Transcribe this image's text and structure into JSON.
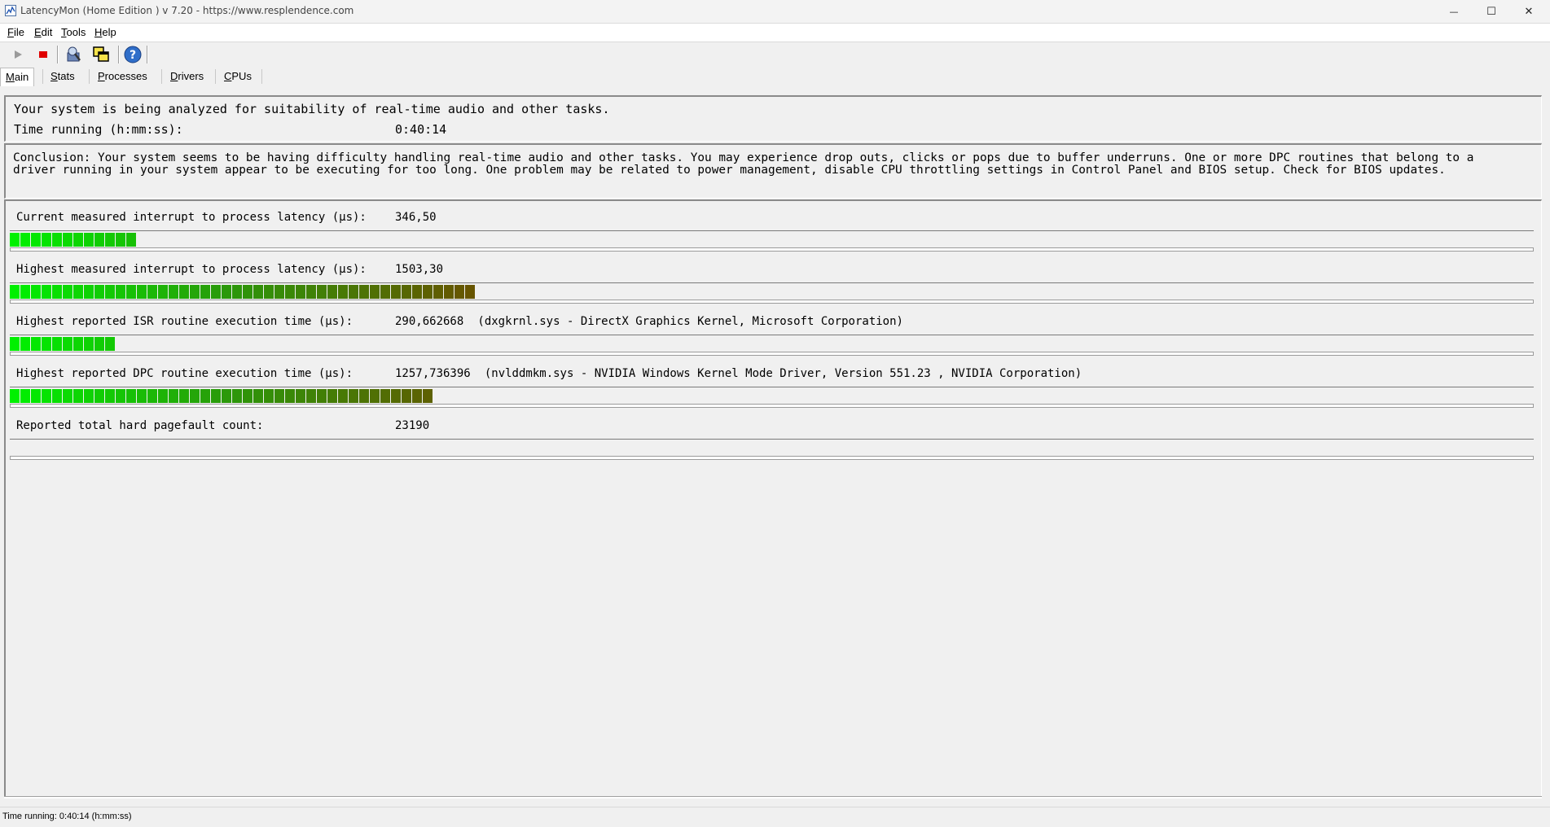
{
  "window": {
    "title": "LatencyMon  (Home Edition )  v 7.20 - https://www.resplendence.com",
    "minimize_glyph": "—",
    "maximize_glyph": "☐",
    "close_glyph": "✕"
  },
  "menu": [
    {
      "key": "F",
      "rest": "ile"
    },
    {
      "key": "E",
      "rest": "dit"
    },
    {
      "key": "T",
      "rest": "ools"
    },
    {
      "key": "H",
      "rest": "elp"
    }
  ],
  "toolbar": {
    "icons": [
      "play-icon",
      "stop-icon",
      "driver-info-icon",
      "windows-icon",
      "help-icon"
    ],
    "stop_color": "#e00000",
    "help_color": "#2f6ec9"
  },
  "tabs": [
    {
      "key": "M",
      "rest": "ain"
    },
    {
      "key": "S",
      "rest": "tats"
    },
    {
      "key": "P",
      "rest": "rocesses"
    },
    {
      "key": "D",
      "rest": "rivers"
    },
    {
      "key": "C",
      "rest": "PUs"
    }
  ],
  "summary": {
    "status": "Your system is being analyzed for suitability of real-time audio and other tasks.",
    "time_label": "Time running (h:mm:ss):",
    "time_value": "0:40:14"
  },
  "conclusion": {
    "line1": "Conclusion: Your system seems to be having difficulty handling real-time audio and other tasks. You may experience drop outs, clicks or pops due to buffer underruns. One or more DPC routines that belong to a",
    "line2": "driver running in your system appear to be executing for too long. One problem may be related to power management, disable CPU throttling settings in Control Panel and BIOS setup. Check for BIOS updates."
  },
  "metrics": [
    {
      "label": "Current measured interrupt to process latency (µs):",
      "value": "346,50",
      "detail": "",
      "blocks": 12
    },
    {
      "label": "Highest measured interrupt to process latency (µs):",
      "value": "1503,30",
      "detail": "",
      "blocks": 44
    },
    {
      "label": "Highest reported ISR routine execution time (µs):",
      "value": "290,662668",
      "detail": "(dxgkrnl.sys - DirectX Graphics Kernel, Microsoft Corporation)",
      "blocks": 10
    },
    {
      "label": "Highest reported DPC routine execution time (µs):",
      "value": "1257,736396",
      "detail": "(nvlddmkm.sys - NVIDIA Windows Kernel Mode Driver, Version 551.23 , NVIDIA Corporation)",
      "blocks": 40
    },
    {
      "label": "Reported total hard pagefault count:",
      "value": "23190",
      "detail": "",
      "blocks": 0
    }
  ],
  "meter_colors": {
    "start": "#00f000",
    "mid": "#2a9a0a",
    "end": "#6a5200"
  },
  "statusbar": {
    "text": "Time running: 0:40:14  (h:mm:ss)"
  }
}
